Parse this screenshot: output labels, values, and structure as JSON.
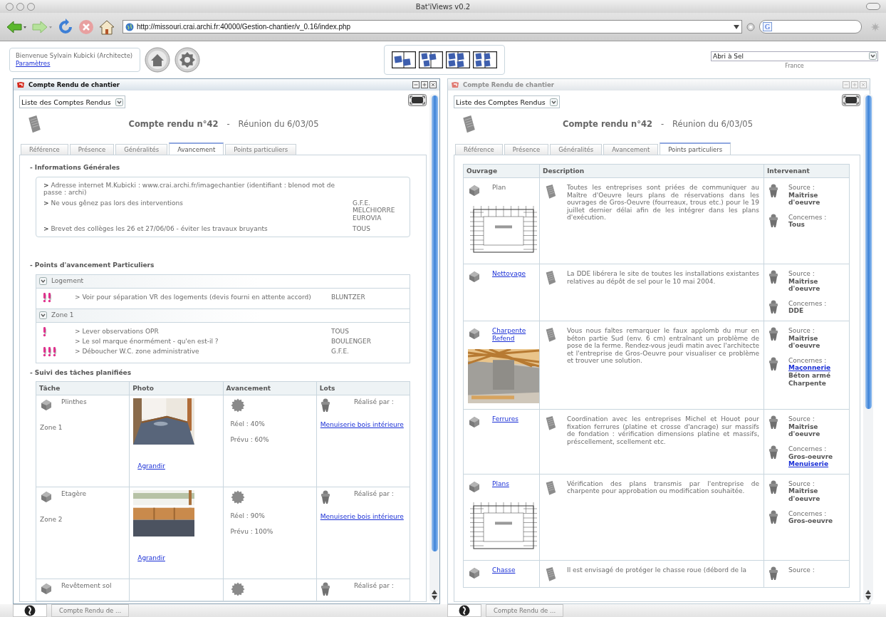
{
  "browser": {
    "title": "Bat'iViews v0.2",
    "url": "http://missouri.crai.archi.fr:40000/Gestion-chantier/v_0.16/index.php",
    "search": {
      "engine_mark": "G"
    }
  },
  "header": {
    "welcome": "Bienvenue Sylvain Kubicki (Architecte)",
    "settings_link": "Paramètres",
    "project": "Abri à Sel",
    "country": "France"
  },
  "panels": [
    {
      "title": "Compte Rendu de chantier",
      "active": true,
      "report_list": "Liste des Comptes Rendus",
      "report_title": "Compte rendu n°42",
      "separator": "-",
      "meeting": "Réunion du 6/03/05",
      "tabs": [
        {
          "label": "Référence",
          "selected": false
        },
        {
          "label": "Présence",
          "selected": false
        },
        {
          "label": "Généralités",
          "selected": false
        },
        {
          "label": "Avancement",
          "selected": true
        },
        {
          "label": "Points particuliers",
          "selected": false
        }
      ],
      "content": {
        "kind": "progress",
        "info_heading": "- Informations Générales",
        "info_items": [
          {
            "text": "**>** Adresse internet M.Kubicki : www.crai.archi.fr/imagechantier (identifiant : blenod mot de passe : archi)"
          },
          {
            "text": "**>** Ne vous gênez pas lors des interventions",
            "who": [
              "G.F.E.",
              "MELCHIORRE",
              "EUROVIA"
            ]
          },
          {
            "text": "**>** Brevet des collèges les 26 et 27/06/06 - éviter les travaux bruyants",
            "who": [
              "TOUS"
            ]
          }
        ],
        "points_heading": "- Points d'avancement Particuliers",
        "groups": [
          {
            "name": "Logement",
            "expanded": true,
            "items": [
              {
                "kind": "medium",
                "text": "> Voir pour séparation VR des logements (devis fourni en attente accord)",
                "who": "BLUNTZER"
              }
            ]
          },
          {
            "name": "Zone 1",
            "expanded": true,
            "items": [
              {
                "kind": "low",
                "text": "> Lever observations OPR",
                "who": "TOUS"
              },
              {
                "kind": "none",
                "text": "> Le sol marque énormément - qu'en est-il ?",
                "who": "BOULENGER"
              },
              {
                "kind": "high",
                "text": "> Déboucher W.C. zone administrative",
                "who": "G.F.E."
              }
            ]
          }
        ],
        "tasks_heading": "- Suivi des tâches planifiées",
        "tasks_table": {
          "columns": [
            "Tâche",
            "Photo",
            "Avancement",
            "Lots"
          ],
          "rows": [
            {
              "task": "Plinthes",
              "zone": "Zone 1",
              "photo": {
                "kind": "picture"
              },
              "photo_link": "Agrandir",
              "real": "Réel : 40%",
              "planned": "Prévu : 60%",
              "lot_label": "Réalisé par :",
              "lot_link": "Menuiserie bois intérieure"
            },
            {
              "task": "Etagère",
              "zone": "Zone 2",
              "photo": {
                "kind": "picture"
              },
              "photo_link": "Agrandir",
              "real": "Réel : 90%",
              "planned": "Prévu : 100%",
              "lot_label": "Réalisé par :",
              "lot_link": "Menuiserie bois intérieure"
            },
            {
              "task": "Revêtement sol",
              "lot_label": "Réalisé par :"
            }
          ]
        }
      }
    },
    {
      "title": "Compte Rendu de chantier",
      "active": false,
      "report_list": "Liste des Comptes Rendus",
      "report_title": "Compte rendu n°42",
      "separator": "-",
      "meeting": "Réunion du 6/03/05",
      "tabs": [
        {
          "label": "Référence",
          "selected": false
        },
        {
          "label": "Présence",
          "selected": false
        },
        {
          "label": "Généralités",
          "selected": false
        },
        {
          "label": "Avancement",
          "selected": false
        },
        {
          "label": "Points particuliers",
          "selected": true
        }
      ],
      "content": {
        "kind": "points",
        "table": {
          "columns": [
            "Ouvrage",
            "Description",
            "Intervenant"
          ],
          "rows": [
            {
              "ouvrage": "Plan",
              "link": false,
              "image": {
                "kind": "picture"
              },
              "description": "Toutes les entreprises sont priées de communiquer au Maître d'Oeuvre leurs plans de réservations dans les ouvrages de Gros-Oeuvre (fourreaux, trous etc.) pour le 19 juillet dernier délai afin de les intégrer dans les plans d'exécution.",
              "source_label": "Source :",
              "source": [
                {
                  "text": "Maîtrise d'oeuvre",
                  "link": false
                }
              ],
              "concerns_label": "Concernes :",
              "concerns": [
                {
                  "text": "Tous",
                  "link": false
                }
              ]
            },
            {
              "ouvrage": "Nettoyage",
              "link": true,
              "description": "La DDE libérera le site de toutes les installations existantes relatives au dépôt de sel pour le 10 mai 2004.",
              "source_label": "Source :",
              "source": [
                {
                  "text": "Maîtrise d'oeuvre",
                  "link": false
                }
              ],
              "concerns_label": "Concernes :",
              "concerns": [
                {
                  "text": "DDE",
                  "link": false
                }
              ]
            },
            {
              "ouvrage": "Charpente Refend",
              "link": true,
              "image": {
                "kind": "picture"
              },
              "description": "Vous nous faîtes remarquer le faux applomb du mur en béton partie Sud (env. 6 cm) entraînant un problème de pose de la ferme. Rendez-vous jeudi matin avec l'architecte et l'entreprise de Gros-Oeuvre pour visualiser ce problème et trouver une solution.",
              "source_label": "Source :",
              "source": [
                {
                  "text": "Maîtrise d'oeuvre",
                  "link": false
                }
              ],
              "concerns_label": "Concernes :",
              "concerns": [
                {
                  "text": "Maçonnerie",
                  "link": true
                },
                {
                  "text": "Béton armé",
                  "link": false
                },
                {
                  "text": "Charpente",
                  "link": false
                }
              ]
            },
            {
              "ouvrage": "Ferrures",
              "link": true,
              "description": "Coordination avec les entreprises Michel et Houot pour fixation ferrures (platine et crosse d'ancrage) sur massifs de fondation : vérification dimensions platine et massifs, préscellement, scellement etc.",
              "source_label": "Source :",
              "source": [
                {
                  "text": "Maîtrise d'oeuvre",
                  "link": false
                }
              ],
              "concerns_label": "Concernes :",
              "concerns": [
                {
                  "text": "Gros-oeuvre",
                  "link": false
                },
                {
                  "text": "Menuiserie",
                  "link": true
                }
              ]
            },
            {
              "ouvrage": "Plans",
              "link": true,
              "image": {
                "kind": "picture"
              },
              "description": "Vérification des plans transmis par l'entreprise de charpente pour approbation ou modification souhaitée.",
              "source_label": "Source :",
              "source": [
                {
                  "text": "Maîtrise d'oeuvre",
                  "link": false
                }
              ],
              "concerns_label": "Concernes :",
              "concerns": [
                {
                  "text": "Gros-oeuvre",
                  "link": false
                }
              ]
            },
            {
              "ouvrage": "Chasse",
              "link": true,
              "description": "Il est envisagé de protéger le chasse roue (débord de la",
              "source_label": "Source :"
            }
          ]
        }
      }
    }
  ],
  "taskbar": [
    {
      "label": "Compte Rendu de ..."
    },
    {
      "label": "Compte Rendu de ..."
    }
  ]
}
